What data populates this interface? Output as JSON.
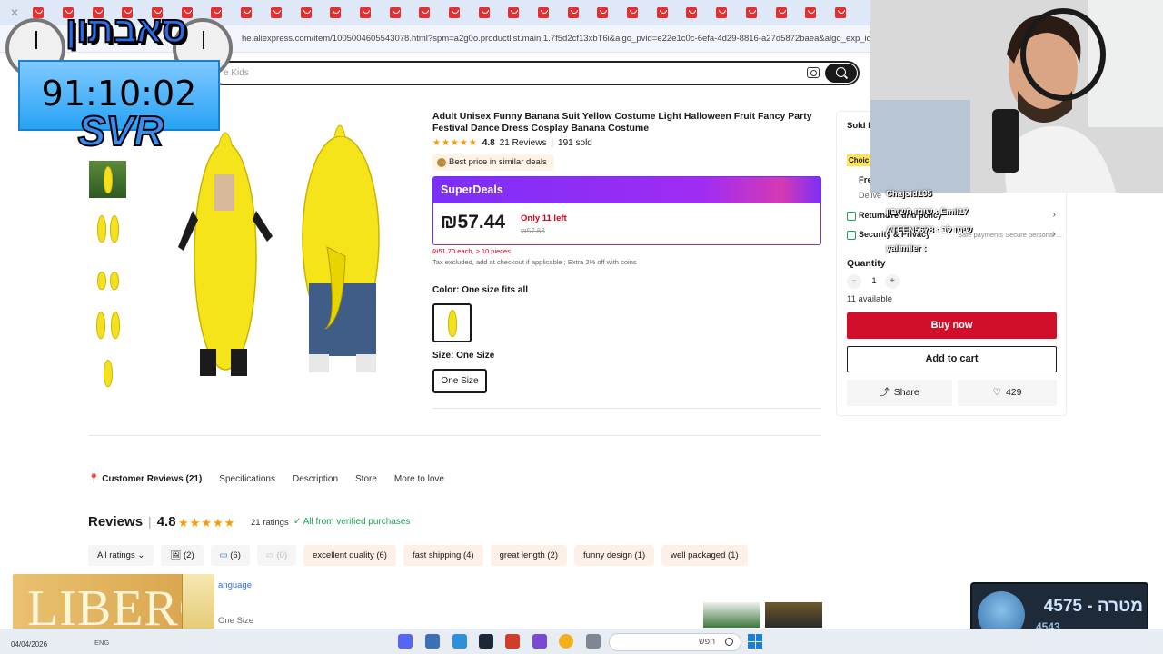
{
  "browser": {
    "url": "he.aliexpress.com/item/1005004605543078.html?spm=a2g0o.productlist.main.1.7f5d2cf13xbT6i&algo_pvid=e22e1c0c-6efa-4d29-8816-a27d5872baea&algo_exp_id=e22"
  },
  "search": {
    "placeholder": "e Kids"
  },
  "product": {
    "title": "Adult Unisex Funny Banana Suit Yellow Costume Light Halloween Fruit Fancy Party Festival Dance Dress Cosplay Banana Costume",
    "stars": "★★★★★",
    "rating": "4.8",
    "reviews": "21 Reviews",
    "sold": "191 sold",
    "best_price_badge": "Best price in similar deals",
    "superdeals_label": "SuperDeals",
    "price": "₪57.44",
    "stock_note": "Only 11 left",
    "old_price": "₪57.63",
    "bulk_price": "₪51.70 each, ≥ 10 pieces",
    "tax_note": "Tax excluded, add at checkout if applicable ; Extra 2% off with coins",
    "color_label": "Color: One size fits all",
    "size_label": "Size: One Size",
    "size_option": "One Size"
  },
  "side_panel": {
    "sold_by": "Sold B",
    "choice": "Choic",
    "free_shipping": "Fre",
    "delivery": "Delive",
    "return_policy": "Return&refund policy",
    "security": "Security & Privacy",
    "security_sub": "Safe payments  Secure personal ...",
    "quantity_label": "Quantity",
    "qty_minus": "−",
    "quantity_value": "1",
    "qty_plus": "+",
    "available": "11 available",
    "buy_now": "Buy now",
    "add_to_cart": "Add to cart",
    "share": "Share",
    "wishlist_count": "429"
  },
  "tabs": [
    {
      "label": "Customer Reviews (21)"
    },
    {
      "label": "Specifications"
    },
    {
      "label": "Description"
    },
    {
      "label": "Store"
    },
    {
      "label": "More to love"
    }
  ],
  "reviews": {
    "title": "Reviews",
    "score": "4.8",
    "stars": "★★★★★",
    "ratings": "21 ratings",
    "verified": "✓ All from verified purchases",
    "filters": [
      {
        "label": "All ratings ⌄"
      },
      {
        "label": "🖼 (2)"
      },
      {
        "label": "(6)"
      },
      {
        "label": "(0)"
      },
      {
        "label": "excellent quality (6)"
      },
      {
        "label": "fast shipping (4)"
      },
      {
        "label": "great length (2)"
      },
      {
        "label": "funny design (1)"
      },
      {
        "label": "well packaged (1)"
      }
    ],
    "language_link": "anguage",
    "size_note": "One Size"
  },
  "stream": {
    "logo": "סאבתון",
    "timer": "91:10:02",
    "tag": "SVR",
    "chat": [
      {
        "text": "Chajoid135"
      },
      {
        "text": "שימו חשיבון : Emil17"
      },
      {
        "text": "ATEEN5678 : שימו לב"
      },
      {
        "text": "yalimiler :"
      }
    ],
    "goal_text": "מטרה - 4575",
    "goal_current": "4543",
    "ad_text": "LIBERO"
  },
  "taskbar": {
    "date": "04/04/2026",
    "lang": "ENG",
    "search_text": "חפש"
  },
  "colors": {
    "accent_red": "#d20f2a",
    "superdeals_purple": "#7b2ff7",
    "star_orange": "#fa9a00",
    "verified_green": "#1b9f52"
  }
}
